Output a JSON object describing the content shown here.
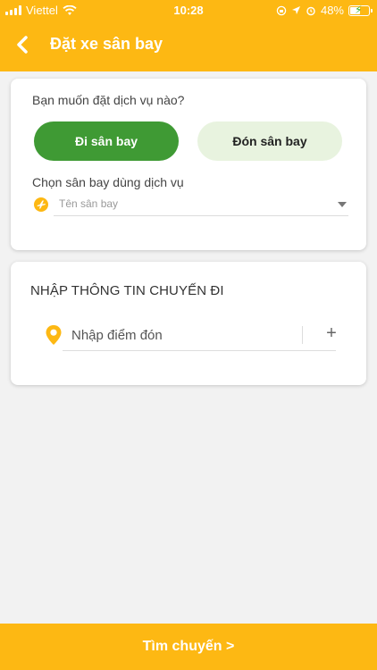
{
  "colors": {
    "primary": "#fdb813",
    "green": "#3f9a34",
    "green_light": "#e8f3df"
  },
  "status_bar": {
    "carrier": "Viettel",
    "time": "10:28",
    "battery": "48%"
  },
  "header": {
    "title": "Đặt xe sân bay",
    "back_icon": "chevron-left-icon"
  },
  "service": {
    "question": "Bạn muốn đặt dịch vụ nào?",
    "options": [
      {
        "label": "Đi sân bay",
        "selected": true
      },
      {
        "label": "Đón sân bay",
        "selected": false
      }
    ],
    "airport_label": "Chọn sân bay dùng dịch vụ",
    "airport_placeholder": "Tên sân bay",
    "airport_icon": "airplane-icon"
  },
  "trip": {
    "title": "NHẬP THÔNG TIN CHUYẾN ĐI",
    "pickup_placeholder": "Nhập điểm đón",
    "pin_icon": "location-pin-icon",
    "add_icon": "plus-icon"
  },
  "footer": {
    "search_label": "Tìm chuyến >"
  }
}
